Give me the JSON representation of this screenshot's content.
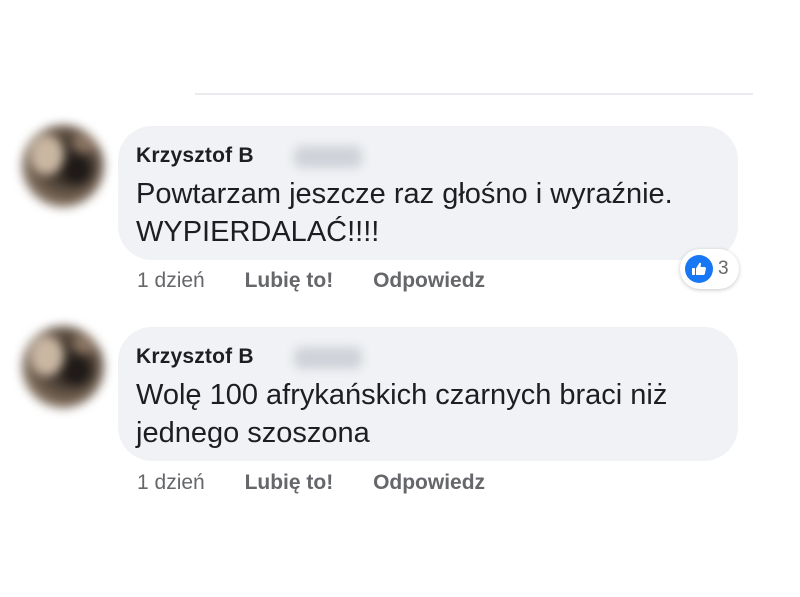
{
  "comments": [
    {
      "author": "Krzysztof B",
      "text_line_1": "Powtarzam jeszcze raz głośno i wyraźnie.",
      "text_line_2": "WYPIERDALAĆ!!!!",
      "time": "1 dzień",
      "like_label": "Lubię to!",
      "reply_label": "Odpowiedz",
      "reaction": {
        "icon": "thumbs-up-icon",
        "count": "3",
        "color": "#1877f2"
      }
    },
    {
      "author": "Krzysztof B",
      "text_line_1": "Wolę 100 afrykańskich czarnych braci niż",
      "text_line_2": "jednego szoszona",
      "time": "1 dzień",
      "like_label": "Lubię to!",
      "reply_label": "Odpowiedz"
    }
  ]
}
